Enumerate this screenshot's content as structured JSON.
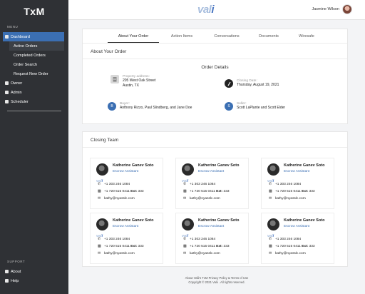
{
  "app": {
    "brand": "TxM",
    "logo_main": "val",
    "logo_accent": "i"
  },
  "sidebar": {
    "menu_label": "MENU",
    "dashboard": "Dashboard",
    "sub_items": [
      "Active Orders",
      "Completed Orders",
      "Order Search",
      "Request New Order"
    ],
    "items": [
      "Owner",
      "Admin",
      "Scheduler"
    ],
    "support_label": "SUPPORT",
    "support_items": [
      "About",
      "Help"
    ]
  },
  "topbar": {
    "user_name": "Jasmine Wilson"
  },
  "tabs": [
    "About Your Order",
    "Action Items",
    "Conversations",
    "Documents",
    "Wiresafe"
  ],
  "about": {
    "section_title": "About Your Order",
    "details_title": "Order Details",
    "property_label": "Property address:",
    "property_line1": "205 West Oak Street",
    "property_line2": "Austin, TX",
    "closing_label": "Closing Date:",
    "closing_value": "Thursday, August 19, 2021",
    "buyer_label": "Buyer:",
    "buyer_value": "Anthony Rizzo, Paul Slindberg, and Jane Doe",
    "buyer_initial": "B",
    "seller_label": "Seller:",
    "seller_value": "Scott LaPlante and Scott Elder",
    "seller_initial": "S"
  },
  "team": {
    "section_title": "Closing Team",
    "brand": "val",
    "brand_accent": "i",
    "agents": [
      {
        "name": "Katherine Ganev Soto",
        "role": "Escrow Assistant",
        "phone": "+1 303 246 1084",
        "fax": "+1 720 515 0411",
        "ext_label": "Ext:",
        "ext": "333",
        "email": "kathy@nyasslc.com"
      },
      {
        "name": "Katherine Ganev Soto",
        "role": "Escrow Assistant",
        "phone": "+1 303 246 1084",
        "fax": "+1 720 515 0411",
        "ext_label": "Ext:",
        "ext": "333",
        "email": "kathy@nyasslc.com"
      },
      {
        "name": "Katherine Ganev Soto",
        "role": "Escrow Assistant",
        "phone": "+1 303 246 1084",
        "fax": "+1 720 515 0411",
        "ext_label": "Ext:",
        "ext": "333",
        "email": "kathy@nyasslc.com"
      },
      {
        "name": "Katherine Ganev Soto",
        "role": "Escrow Assistant",
        "phone": "+1 303 246 1084",
        "fax": "+1 720 515 0411",
        "ext_label": "Ext:",
        "ext": "333",
        "email": "kathy@nyasslc.com"
      },
      {
        "name": "Katherine Ganev Soto",
        "role": "Escrow Assistant",
        "phone": "+1 303 246 1084",
        "fax": "+1 720 515 0411",
        "ext_label": "Ext:",
        "ext": "333",
        "email": "kathy@nyasslc.com"
      },
      {
        "name": "Katherine Ganev Soto",
        "role": "Escrow Assistant",
        "phone": "+1 303 246 1084",
        "fax": "+1 720 515 0411",
        "ext_label": "Ext:",
        "ext": "333",
        "email": "kathy@nyasslc.com"
      }
    ]
  },
  "footer": {
    "line1": "About Valii's TxM Privacy Policy & Terms of Use",
    "line2": "Copyright © 2021 Valii . All rights reserved."
  },
  "colors": {
    "sidebar_bg": "#2f3135",
    "accent": "#3b6fb3",
    "page_bg": "#f3f4f6"
  },
  "icons": [
    "dashboard-icon",
    "owner-icon",
    "admin-icon",
    "scheduler-icon",
    "about-icon",
    "help-icon",
    "building-icon",
    "closing-date-icon",
    "phone-icon",
    "fax-icon",
    "email-icon"
  ]
}
